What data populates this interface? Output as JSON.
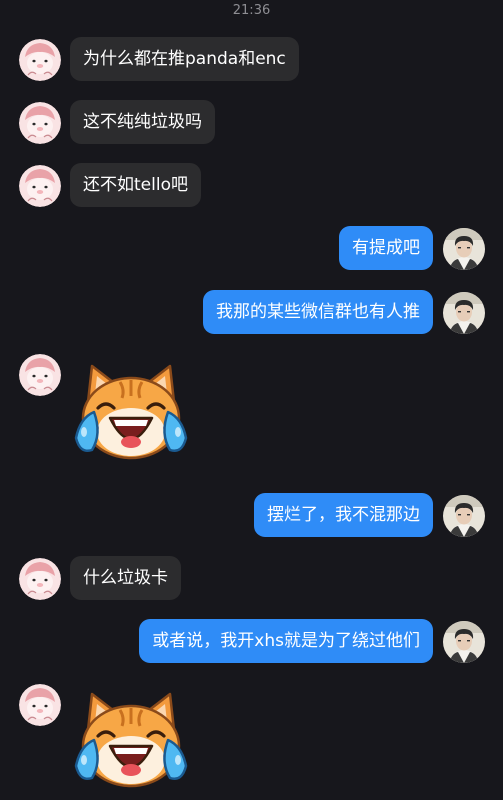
{
  "status": {
    "time": "21:36"
  },
  "messages": [
    {
      "type": "text",
      "side": "left",
      "text": "为什么都在推panda和enc"
    },
    {
      "type": "text",
      "side": "left",
      "text": "这不纯纯垃圾吗"
    },
    {
      "type": "text",
      "side": "left",
      "text": "还不如tello吧"
    },
    {
      "type": "text",
      "side": "right",
      "text": "有提成吧"
    },
    {
      "type": "text",
      "side": "right",
      "text": "我那的某些微信群也有人推"
    },
    {
      "type": "sticker",
      "side": "left",
      "sticker": "crying-laughing-cat"
    },
    {
      "type": "text",
      "side": "right",
      "text": "摆烂了，我不混那边"
    },
    {
      "type": "text",
      "side": "left",
      "text": "什么垃圾卡"
    },
    {
      "type": "text",
      "side": "right",
      "text": "或者说，我开xhs就是为了绕过他们"
    },
    {
      "type": "sticker",
      "side": "left",
      "sticker": "crying-laughing-cat"
    }
  ],
  "colors": {
    "background": "#17171c",
    "incoming_bubble": "#2c2c2e",
    "outgoing_bubble": "#2f8cf7"
  }
}
